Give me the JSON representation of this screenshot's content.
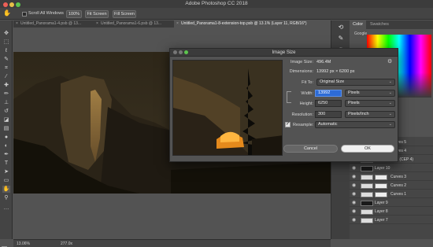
{
  "app_title": "Adobe Photoshop CC 2018",
  "options_bar": {
    "scroll_all_windows": "Scroll All Windows",
    "zoom_100": "100%",
    "fit_screen": "Fit Screen",
    "fill_screen": "Fill Screen"
  },
  "tabs": [
    {
      "label": "Untitled_Panorama1-4.psb @ 13..."
    },
    {
      "label": "Untitled_Panorama1-6.psb @ 13..."
    },
    {
      "label": "Untitled_Panorama1-8-extension-top.psb @ 13.1% (Layer 11, RGB/16*)"
    }
  ],
  "status": {
    "zoom": "13.06%",
    "doc": "277.0x"
  },
  "panel": {
    "tab_color": "Color",
    "tab_swatches": "Swatches",
    "search_hint": "Google"
  },
  "layers": [
    {
      "name": "Curves 5"
    },
    {
      "name": "Curves 4"
    },
    {
      "name": "Skylight Filter (CEP 4)"
    },
    {
      "name": "Layer 10"
    },
    {
      "name": "Curves 3"
    },
    {
      "name": "Curves 2"
    },
    {
      "name": "Curves 1"
    },
    {
      "name": "Layer 9"
    },
    {
      "name": "Layer 8"
    },
    {
      "name": "Layer 7"
    }
  ],
  "dialog": {
    "title": "Image Size",
    "image_size_label": "Image Size:",
    "image_size_value": "496.4M",
    "dimensions_label": "Dimensions:",
    "dimensions_value": "13992 px  ×  6200 px",
    "fit_to_label": "Fit To:",
    "fit_to_value": "Original Size",
    "width_label": "Width:",
    "width_value": "13992",
    "width_unit": "Pixels",
    "height_label": "Height:",
    "height_value": "6250",
    "height_unit": "Pixels",
    "resolution_label": "Resolution:",
    "resolution_value": "300",
    "resolution_unit": "Pixels/Inch",
    "resample_label": "Resample:",
    "resample_value": "Automatic",
    "cancel": "Cancel",
    "ok": "OK"
  }
}
